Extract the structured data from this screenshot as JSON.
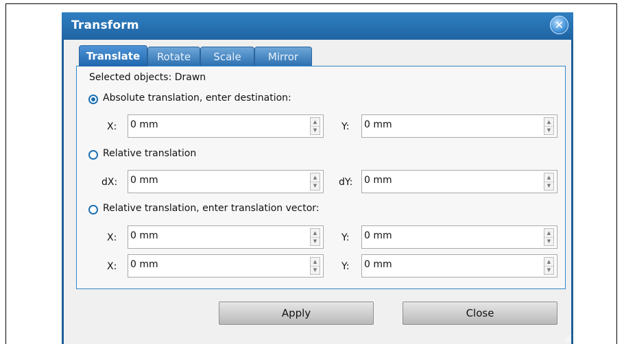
{
  "window": {
    "title": "Transform",
    "close_icon": "close-icon"
  },
  "tabs": [
    {
      "label": "Translate",
      "active": true
    },
    {
      "label": "Rotate",
      "active": false
    },
    {
      "label": "Scale",
      "active": false
    },
    {
      "label": "Mirror",
      "active": false
    }
  ],
  "panel": {
    "selected_objects": "Selected objects: Drawn",
    "option_absolute": {
      "label": "Absolute translation, enter destination:",
      "selected": true
    },
    "option_relative": {
      "label": "Relative translation",
      "selected": false
    },
    "option_vector": {
      "label": "Relative translation, enter translation vector:",
      "selected": false
    },
    "abs_x": {
      "label": "X:",
      "value": "0 mm"
    },
    "abs_y": {
      "label": "Y:",
      "value": "0 mm"
    },
    "rel_dx": {
      "label": "dX:",
      "value": "0 mm"
    },
    "rel_dy": {
      "label": "dY:",
      "value": "0 mm"
    },
    "vec1_x": {
      "label": "X:",
      "value": "0 mm"
    },
    "vec1_y": {
      "label": "Y:",
      "value": "0 mm"
    },
    "vec2_x": {
      "label": "X:",
      "value": "0 mm"
    },
    "vec2_y": {
      "label": "Y:",
      "value": "0 mm"
    }
  },
  "buttons": {
    "apply": "Apply",
    "close": "Close"
  },
  "colors": {
    "title_bar": "#1f64a3",
    "accent": "#1c6fb3"
  }
}
